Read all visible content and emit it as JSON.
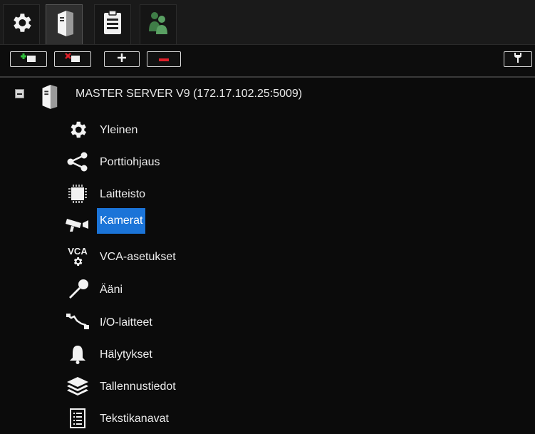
{
  "tabs": [
    {
      "icon": "gear-icon",
      "active": false
    },
    {
      "icon": "server-icon",
      "active": true
    },
    {
      "icon": "clipboard-icon",
      "active": false
    },
    {
      "icon": "users-icon",
      "active": false
    }
  ],
  "toolbar": {
    "buttons": [
      {
        "icon": "add-server-icon"
      },
      {
        "icon": "remove-server-icon"
      },
      {
        "icon": "plus-icon",
        "label": "+"
      },
      {
        "icon": "minus-icon",
        "label": "−"
      },
      {
        "icon": "wrench-icon"
      }
    ]
  },
  "tree": {
    "server": {
      "label": "MASTER SERVER V9 (172.17.102.25:5009)",
      "expanded": true
    },
    "items": [
      {
        "label": "Yleinen",
        "icon": "gear-icon"
      },
      {
        "label": "Porttiohjaus",
        "icon": "share-icon"
      },
      {
        "label": "Laitteisto",
        "icon": "chip-icon"
      },
      {
        "label": "Kamerat",
        "icon": "camera-icon",
        "selected": true
      },
      {
        "label": "VCA-asetukset",
        "icon": "vca-icon",
        "icon_text": "VCA"
      },
      {
        "label": "Ääni",
        "icon": "microphone-icon"
      },
      {
        "label": "I/O-laitteet",
        "icon": "io-cable-icon"
      },
      {
        "label": "Hälytykset",
        "icon": "bell-icon"
      },
      {
        "label": "Tallennustiedot",
        "icon": "layers-icon"
      },
      {
        "label": "Tekstikanavat",
        "icon": "text-list-icon"
      }
    ]
  },
  "colors": {
    "background": "#0b0b0b",
    "selection": "#1b74d8",
    "users_icon": "#4f8f58"
  }
}
